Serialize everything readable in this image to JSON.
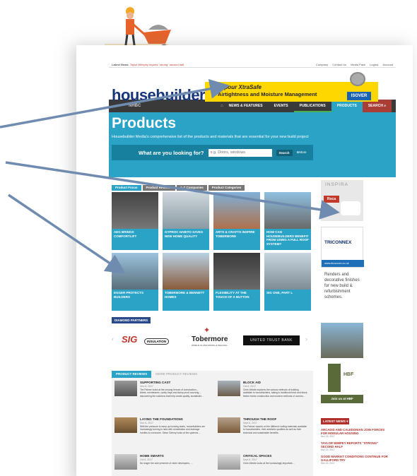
{
  "topbar": {
    "latest_prefix": "Latest News:",
    "latest_text": "Taylor Wimpey reports \"strong\" second half",
    "nav": [
      "Company",
      "Contact Us",
      "Media Pack",
      "Logout",
      "Account"
    ]
  },
  "brand": {
    "logo": "housebuilder"
  },
  "ad": {
    "line1": "Vapour XtraSafe",
    "line2": "Airtightness and Moisture Management",
    "brand": "ISOVER"
  },
  "navbar": {
    "nhbc": "NHBC",
    "items": [
      "NEWS & FEATURES",
      "EVENTS",
      "PUBLICATIONS",
      "PRODUCTS",
      "SEARCH"
    ]
  },
  "hero": {
    "title": "Products",
    "subtitle": "Housebuilder Media's comprehensive list of the products and materials that are essential for your new build project",
    "search_label": "What are you looking for?",
    "search_placeholder": "e.g. Doors, windows",
    "search_button": "Search",
    "more": "More"
  },
  "tabs": [
    "Product Focus",
    "Product Reviews",
    "A-Z Companies",
    "Product Categories"
  ],
  "tiles": [
    "AEG BRINGS COMFORTLIFT",
    "GYPROC HABITO SAVES NEW HOME QUALITY",
    "ARTS & CRAFTS INSPIRE TOBERMORE",
    "HOW CAN HOUSEBUILDERS BENEFIT FROM USING A FULL ROOF SYSTEM?",
    "EGGER PROTECTS BUILDERS",
    "TOBERMORE & BENNETT HOMES",
    "FLEXIBILITY AT THE TOUCH OF A BUTTON",
    "SIG ONE, PART L"
  ],
  "sidebar": {
    "inspira": "INSPIRA",
    "roca": "Roca",
    "triconnex": "TRICONNEX",
    "triconnex_url": "www.triconnex.co.uk",
    "render_text": "Renders and decorative finishes for new build & refurbishment schemes.",
    "hbf": "HBF",
    "hbf_join": "Join us at HBF"
  },
  "diamond": "DIAMOND PARTNERS",
  "partners": {
    "sig": "SIG",
    "sig_sub": "INSULATION",
    "tobermore": "Tobermore",
    "tobermore_sub": "WORLD CLASS PAVING & WALLING",
    "utb": "UNITED TRUST BANK"
  },
  "reviews": {
    "tab_active": "PRODUCT REVIEWS",
    "tab_inactive": "MORE PRODUCT REVIEWS",
    "items": [
      {
        "title": "SUPPORTING CAST",
        "date": "Nov 6, 2017",
        "body": "Tim Palmer looks at the unsung heroes of construction – lintels, membranes, cavity trays and damp proof coursing – discovering the solutions that help create quality, sustainabl..."
      },
      {
        "title": "BLOCK AID",
        "date": "Oct 6, 2017",
        "body": "Chris Windle explores the various methods of building available to housebuilders, taking in traditional brick and block, timber frame construction and modern methods of constru..."
      },
      {
        "title": "LAYING THE FOUNDATIONS",
        "date": "Nov 6, 2017",
        "body": "With the pressure to ramp up housing starts, housebuilders are increasingly turning to land with remediation and drainage hurdles to overcome. Steve Glenny looks at the systems ..."
      },
      {
        "title": "THROUGH THE ROOF",
        "date": "Sept 6, 2017",
        "body": "Tim Palmer reports on the different roofing materials available to housebuilders, their aesthetic qualities as well as their technical and sustainable benefits."
      },
      {
        "title": "HOME SMARTS",
        "date": "Oct 6, 2017",
        "body": "No longer the sole preserve of niche developers, ..."
      },
      {
        "title": "CRITICAL SPACES",
        "date": "Sept 6, 2017",
        "body": "Chris Windle looks at the increasingly important ..."
      }
    ]
  },
  "latest": {
    "header": "LATEST NEWS",
    "items": [
      {
        "title": "ARCADIS AND CALEDONIAN JOIN FORCES FOR MODULAR HOUSING",
        "date": "Nov 15, 2017"
      },
      {
        "title": "TAYLOR WIMPEY REPORTS \"STRONG\" SECOND HALF",
        "date": "Nov 15, 2017"
      },
      {
        "title": "GOOD MARKET CONDITIONS CONTINUE FOR GALLIFORD TRY",
        "date": "Nov 15, 2017"
      }
    ]
  }
}
